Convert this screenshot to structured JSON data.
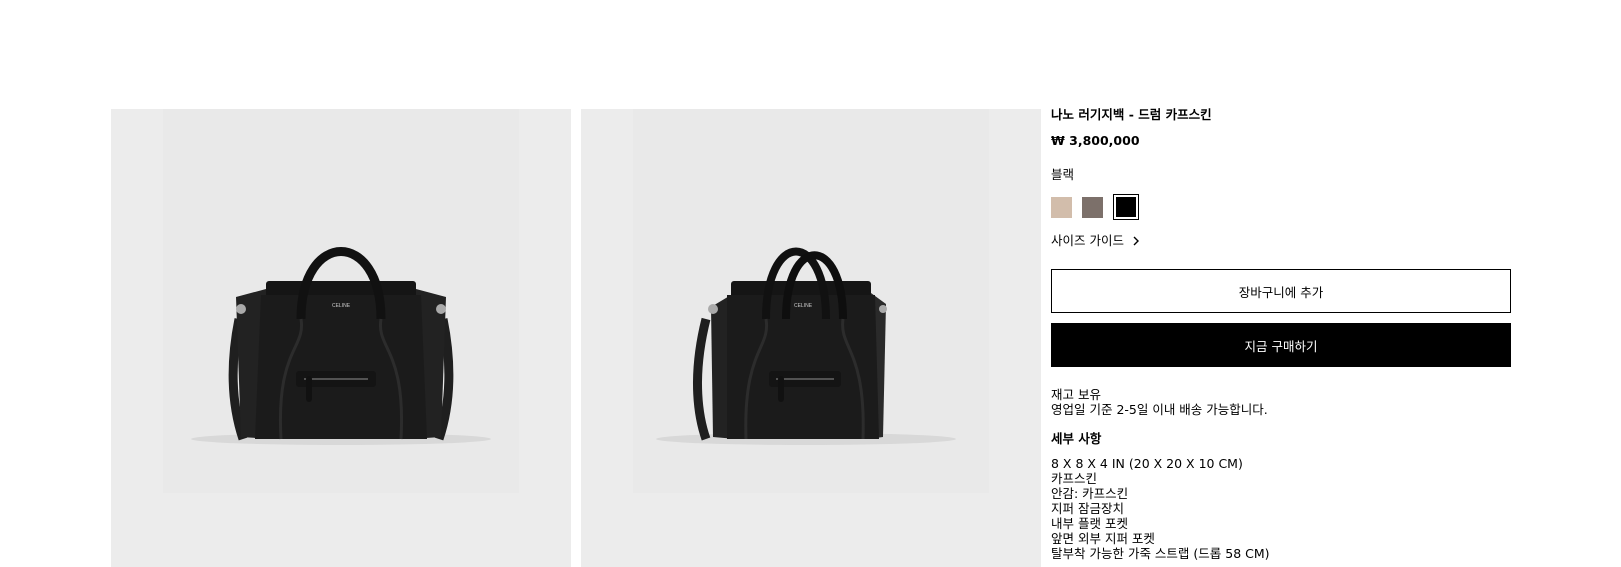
{
  "product": {
    "title": "나노 러기지백 - 드럼 카프스킨",
    "price": "₩ 3,800,000",
    "color_label": "블랙",
    "swatches": [
      {
        "name": "beige",
        "color": "#d2bdab"
      },
      {
        "name": "taupe",
        "color": "#7c706a"
      },
      {
        "name": "black",
        "color": "#000000",
        "selected": true
      }
    ],
    "size_guide_label": "사이즈 가이드",
    "add_to_cart_label": "장바구니에 추가",
    "buy_now_label": "지금 구매하기",
    "stock_status": "재고 보유",
    "delivery_note": "영업일 기준 2-5일 이내 배송 가능합니다.",
    "details_title": "세부 사항",
    "details": [
      "8 X 8 X 4 IN (20 X 20 X 10 CM)",
      "카프스킨",
      "안감: 카프스킨",
      "지퍼 잠금장치",
      "내부 플랫 포켓",
      "앞면 외부 지퍼 포켓",
      "탈부착 가능한 가죽 스트랩 (드롭 58 CM)"
    ],
    "bag_logo_text": "CELINE"
  },
  "colors": {
    "image_background": "#ececec",
    "accent": "#000000"
  }
}
